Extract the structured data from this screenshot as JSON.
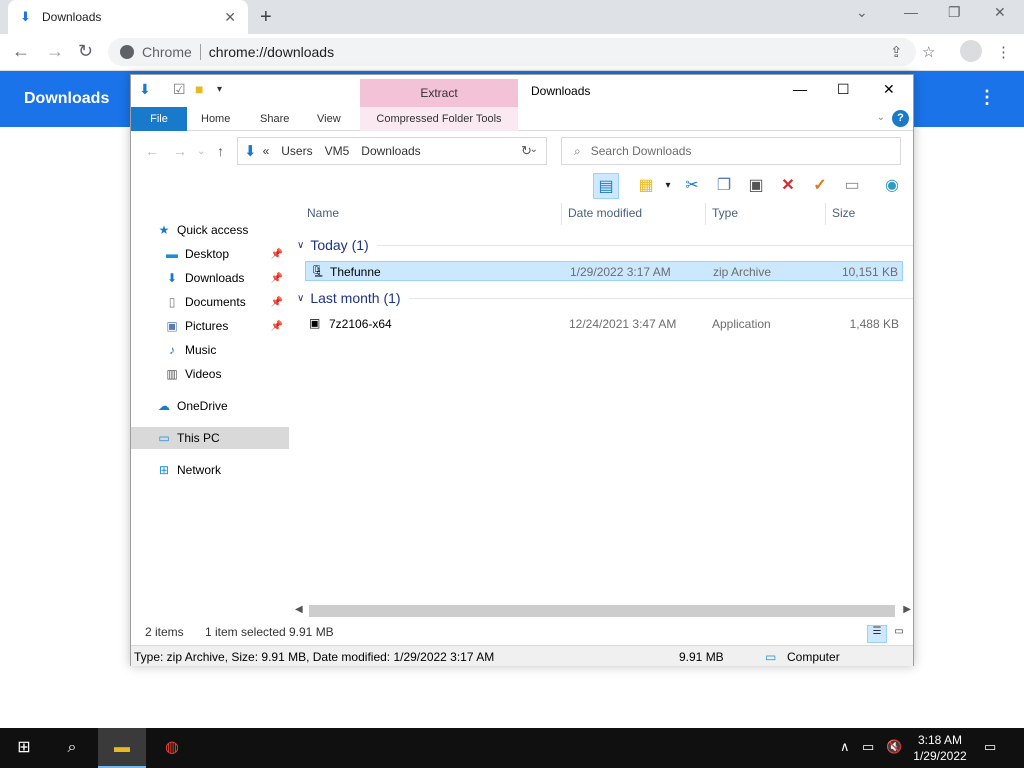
{
  "chrome": {
    "tab_title": "Downloads",
    "omnibox_label": "Chrome",
    "url": "chrome://downloads",
    "page_header": "Downloads",
    "menu_glyph": "⋮"
  },
  "explorer": {
    "window_title": "Downloads",
    "contextual_tab": "Extract",
    "ribbon_tabs": [
      "File",
      "Home",
      "Share",
      "View",
      "Compressed Folder Tools"
    ],
    "address": {
      "overflow": "«",
      "crumbs": [
        "Users",
        "VM5",
        "Downloads"
      ]
    },
    "search_placeholder": "Search Downloads",
    "nav": {
      "quick_access": "Quick access",
      "desktop": "Desktop",
      "downloads": "Downloads",
      "documents": "Documents",
      "pictures": "Pictures",
      "music": "Music",
      "videos": "Videos",
      "onedrive": "OneDrive",
      "this_pc": "This PC",
      "network": "Network"
    },
    "columns": [
      "Name",
      "Date modified",
      "Type",
      "Size"
    ],
    "groups": [
      {
        "label": "Today (1)",
        "files": [
          {
            "name": "Thefunne",
            "date": "1/29/2022 3:17 AM",
            "type": "zip Archive",
            "size": "10,151 KB",
            "selected": true
          }
        ]
      },
      {
        "label": "Last month (1)",
        "files": [
          {
            "name": "7z2106-x64",
            "date": "12/24/2021 3:47 AM",
            "type": "Application",
            "size": "1,488 KB",
            "selected": false
          }
        ]
      }
    ],
    "status": {
      "item_count": "2 items",
      "selection": "1 item selected",
      "selection_size": "9.91 MB"
    },
    "details": {
      "text": "Type: zip Archive, Size: 9.91 MB, Date modified: 1/29/2022 3:17 AM",
      "size": "9.91 MB",
      "location": "Computer"
    }
  },
  "taskbar": {
    "time": "3:18 AM",
    "date": "1/29/2022"
  },
  "colors": {
    "chrome_blue": "#1a73e8",
    "file_tab_blue": "#1979ca",
    "extract_pink": "#f4c2d7",
    "selection": "#cce8ff",
    "group_text": "#1e3287"
  }
}
